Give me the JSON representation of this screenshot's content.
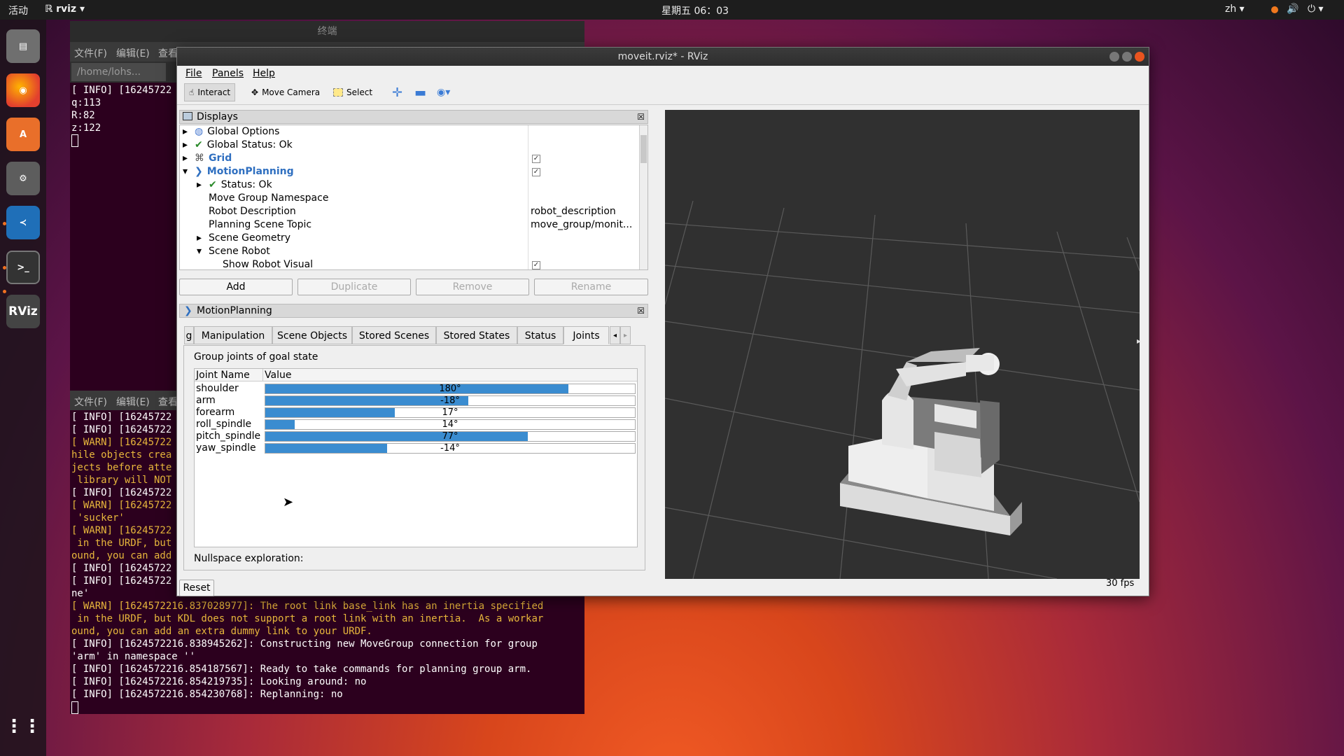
{
  "topbar": {
    "activities": "活动",
    "app_menu": "rviz",
    "clock": "星期五 06：03",
    "input_method": "zh"
  },
  "dock": [
    {
      "name": "files-icon"
    },
    {
      "name": "firefox-icon"
    },
    {
      "name": "software-center-icon"
    },
    {
      "name": "settings-icon"
    },
    {
      "name": "vscode-icon"
    },
    {
      "name": "terminal-icon"
    },
    {
      "name": "rviz-icon",
      "label": "RViz"
    },
    {
      "name": "app-grid-icon"
    }
  ],
  "terminal_top": {
    "title": "终端",
    "menu": [
      "文件(F)",
      "编辑(E)",
      "查看"
    ],
    "tab": "/home/lohs...",
    "lines": [
      "[ INFO] [16245722",
      "q:113",
      "R:82",
      "z:122"
    ]
  },
  "terminal_bottom": {
    "menu": [
      "文件(F)",
      "编辑(E)",
      "查看"
    ],
    "lines": [
      {
        "t": "[ INFO] [16245722",
        "w": false
      },
      {
        "t": "[ INFO] [16245722",
        "w": false
      },
      {
        "t": "[ WARN] [16245722",
        "w": true
      },
      {
        "t": "hile objects crea",
        "w": true
      },
      {
        "t": "jects before atte",
        "w": true
      },
      {
        "t": " library will NOT",
        "w": true
      },
      {
        "t": "[ INFO] [16245722",
        "w": false
      },
      {
        "t": "[ WARN] [16245722",
        "w": true
      },
      {
        "t": " 'sucker'",
        "w": true
      },
      {
        "t": "[ WARN] [16245722",
        "w": true
      },
      {
        "t": " in the URDF, but",
        "w": true
      },
      {
        "t": "ound, you can add",
        "w": true
      },
      {
        "t": "[ INFO] [16245722",
        "w": false
      },
      {
        "t": "[ INFO] [16245722",
        "w": false
      },
      {
        "t": "ne'",
        "w": false
      },
      {
        "t": "[ WARN] [1624572216.837028977]: The root link base_link has an inertia specified",
        "w": true
      },
      {
        "t": " in the URDF, but KDL does not support a root link with an inertia.  As a workar",
        "w": true
      },
      {
        "t": "ound, you can add an extra dummy link to your URDF.",
        "w": true
      },
      {
        "t": "[ INFO] [1624572216.838945262]: Constructing new MoveGroup connection for group",
        "w": false
      },
      {
        "t": "'arm' in namespace ''",
        "w": false
      },
      {
        "t": "[ INFO] [1624572216.854187567]: Ready to take commands for planning group arm.",
        "w": false
      },
      {
        "t": "[ INFO] [1624572216.854219735]: Looking around: no",
        "w": false
      },
      {
        "t": "[ INFO] [1624572216.854230768]: Replanning: no",
        "w": false
      }
    ]
  },
  "rviz": {
    "title": "moveit.rviz* - RViz",
    "menu": {
      "file": "File",
      "panels": "Panels",
      "help": "Help"
    },
    "toolbar": {
      "interact": "Interact",
      "move_camera": "Move Camera",
      "select": "Select"
    },
    "displays": {
      "title": "Displays",
      "rows": [
        {
          "label": "Global Options",
          "value": ""
        },
        {
          "label": "Global Status: Ok",
          "value": ""
        },
        {
          "label": "Grid",
          "value": ""
        },
        {
          "label": "MotionPlanning",
          "value": ""
        },
        {
          "label": "Status: Ok",
          "value": ""
        },
        {
          "label": "Move Group Namespace",
          "value": ""
        },
        {
          "label": "Robot Description",
          "value": "robot_description"
        },
        {
          "label": "Planning Scene Topic",
          "value": "move_group/monit..."
        },
        {
          "label": "Scene Geometry",
          "value": ""
        },
        {
          "label": "Scene Robot",
          "value": ""
        },
        {
          "label": "Show Robot Visual",
          "value": ""
        }
      ],
      "buttons": {
        "add": "Add",
        "duplicate": "Duplicate",
        "remove": "Remove",
        "rename": "Rename"
      }
    },
    "motion": {
      "title": "MotionPlanning",
      "tabs": [
        "g",
        "Manipulation",
        "Scene Objects",
        "Stored Scenes",
        "Stored States",
        "Status",
        "Joints"
      ],
      "group_label": "Group joints of goal state",
      "col_name": "Joint Name",
      "col_value": "Value",
      "joints": [
        {
          "name": "shoulder",
          "value": "180°",
          "fill": 0.82
        },
        {
          "name": "arm",
          "value": "-18°",
          "fill": 0.55
        },
        {
          "name": "forearm",
          "value": "17°",
          "fill": 0.35
        },
        {
          "name": "roll_spindle",
          "value": "14°",
          "fill": 0.08
        },
        {
          "name": "pitch_spindle",
          "value": "77°",
          "fill": 0.71
        },
        {
          "name": "yaw_spindle",
          "value": "-14°",
          "fill": 0.33
        }
      ],
      "nullspace": "Nullspace exploration:"
    },
    "reset": "Reset",
    "fps": "30 fps"
  }
}
